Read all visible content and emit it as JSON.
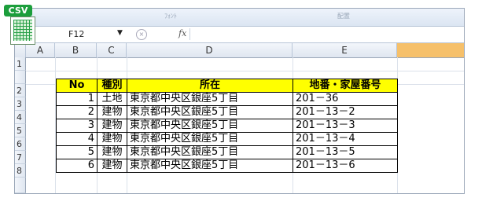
{
  "badge": {
    "label": "CSV"
  },
  "formula_bar": {
    "cell_ref": "F12",
    "fx": "fx",
    "value": ""
  },
  "ribbon_faint": [
    "ﾌｫﾝﾄ",
    "配置"
  ],
  "columns": [
    "A",
    "B",
    "C",
    "D",
    "E"
  ],
  "rows": [
    "1",
    "2",
    "3",
    "4",
    "5",
    "6",
    "7",
    "8"
  ],
  "table": {
    "headers": [
      "No",
      "種別",
      "所在",
      "地番・家屋番号"
    ],
    "rows": [
      [
        "1",
        "土地",
        "東京都中央区銀座5丁目",
        "201－36"
      ],
      [
        "2",
        "建物",
        "東京都中央区銀座5丁目",
        "201－13－2"
      ],
      [
        "3",
        "建物",
        "東京都中央区銀座5丁目",
        "201－13－3"
      ],
      [
        "4",
        "建物",
        "東京都中央区銀座5丁目",
        "201－13－4"
      ],
      [
        "5",
        "建物",
        "東京都中央区銀座5丁目",
        "201－13－5"
      ],
      [
        "6",
        "建物",
        "東京都中央区銀座5丁目",
        "201－13－6"
      ]
    ]
  },
  "colors": {
    "header_fill": "#ffff00",
    "badge": "#1c9e3c",
    "selected_column": "#f6c06a"
  }
}
